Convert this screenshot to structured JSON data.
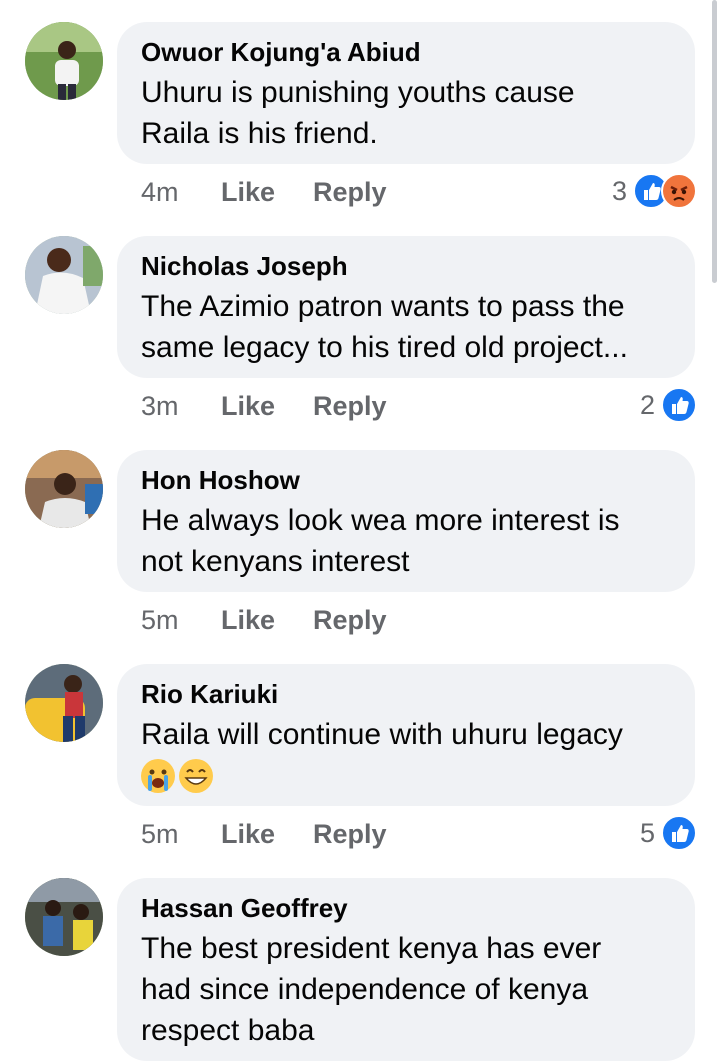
{
  "comments": [
    {
      "name": "Owuor Kojung'a Abiud",
      "text_lines": [
        "Uhuru is punishing  youths cause",
        "Raila is his friend."
      ],
      "time": "4m",
      "like": "Like",
      "reply": "Reply",
      "reaction_count": "3",
      "reactions": [
        "like-icon",
        "angry-icon"
      ]
    },
    {
      "name": "Nicholas Joseph",
      "text_lines": [
        "The Azimio patron wants to pass the",
        "same legacy to his tired old project..."
      ],
      "time": "3m",
      "like": "Like",
      "reply": "Reply",
      "reaction_count": "2",
      "reactions": [
        "like-icon"
      ]
    },
    {
      "name": "Hon Hoshow",
      "text_lines": [
        "He always look wea more interest is",
        "not kenyans interest"
      ],
      "time": "5m",
      "like": "Like",
      "reply": "Reply",
      "reaction_count": "",
      "reactions": []
    },
    {
      "name": "Rio Kariuki",
      "text_lines": [
        "Raila will continue with uhuru legacy"
      ],
      "emojis": [
        "crying-face-emoji",
        "grinning-face-emoji"
      ],
      "time": "5m",
      "like": "Like",
      "reply": "Reply",
      "reaction_count": "5",
      "reactions": [
        "like-icon"
      ]
    },
    {
      "name": "Hassan Geoffrey",
      "text_lines": [
        "The best president kenya has ever",
        "had since independence of kenya",
        "respect baba"
      ]
    }
  ],
  "colors": {
    "bubble": "#f0f2f5",
    "meta_text": "#65676b",
    "like_blue": "#1877f2",
    "angry_orange": "#f0743c"
  }
}
